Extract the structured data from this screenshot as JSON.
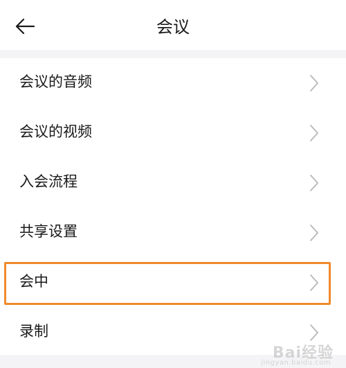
{
  "header": {
    "title": "会议",
    "back_icon": "arrow-left-icon"
  },
  "list": {
    "items": [
      {
        "label": "会议的音频",
        "icon": "chevron-right-icon"
      },
      {
        "label": "会议的视频",
        "icon": "chevron-right-icon"
      },
      {
        "label": "入会流程",
        "icon": "chevron-right-icon"
      },
      {
        "label": "共享设置",
        "icon": "chevron-right-icon"
      },
      {
        "label": "会中",
        "icon": "chevron-right-icon",
        "highlighted": true
      },
      {
        "label": "录制",
        "icon": "chevron-right-icon"
      }
    ]
  },
  "colors": {
    "highlight_border": "#f08a2c",
    "separator_bg": "#f4f4f6",
    "text": "#1a1a1a",
    "chevron": "#b8b8b8"
  },
  "watermark": {
    "text": "Bai经验",
    "subtext": "jingyan.baidu.com"
  }
}
